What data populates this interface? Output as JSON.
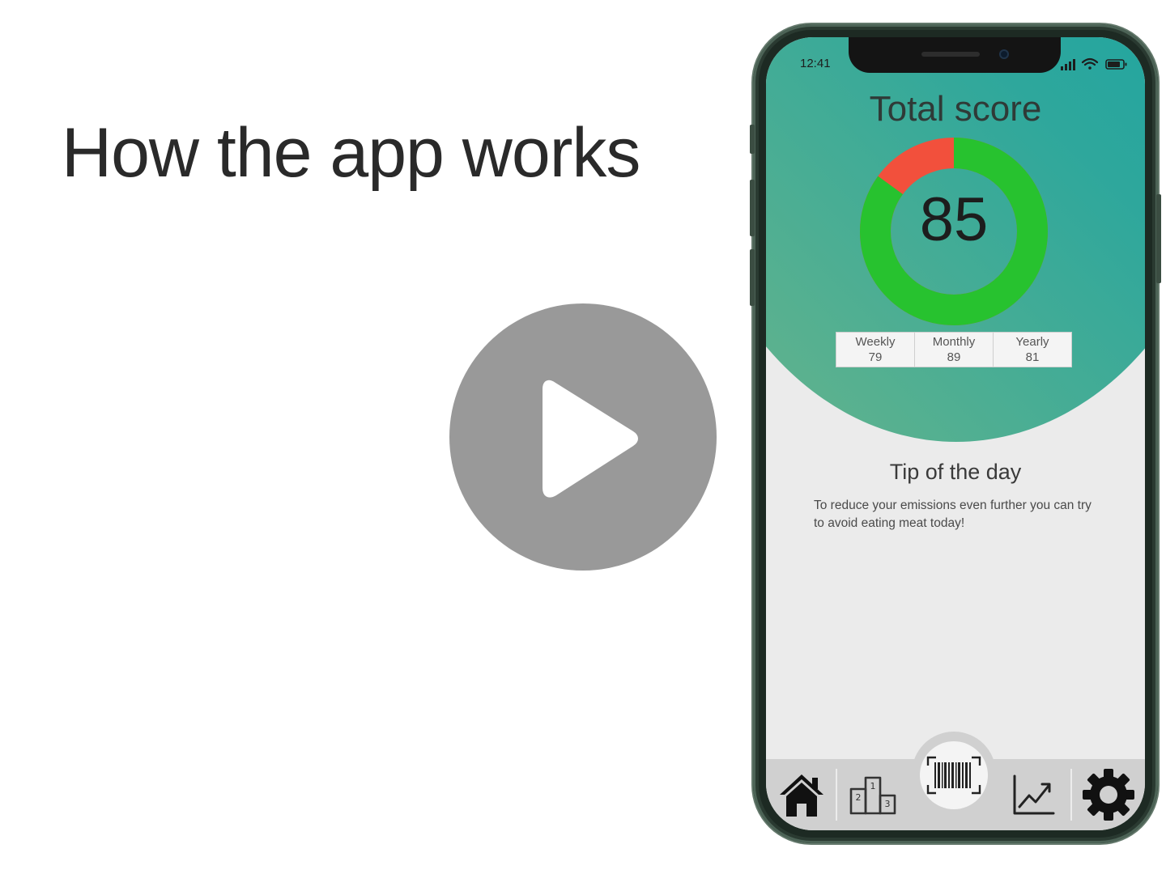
{
  "slide": {
    "title": "How the app works"
  },
  "video": {
    "play_icon": "play-icon"
  },
  "phone": {
    "status_bar": {
      "time": "12:41",
      "icons": [
        "signal-icon",
        "wifi-icon",
        "battery-icon"
      ]
    },
    "score": {
      "title": "Total score",
      "value": "85",
      "fraction": 0.85,
      "colors": {
        "achieved": "#27c22f",
        "remaining": "#f2503c"
      }
    },
    "periods": [
      {
        "label": "Weekly",
        "value": "79"
      },
      {
        "label": "Monthly",
        "value": "89"
      },
      {
        "label": "Yearly",
        "value": "81"
      }
    ],
    "tip": {
      "title": "Tip of the day",
      "text": "To reduce your emissions even further you can try to avoid eating meat today!"
    },
    "tab_bar": {
      "tabs": [
        {
          "icon": "home-icon"
        },
        {
          "icon": "podium-icon"
        },
        {
          "icon": "barcode-scanner-icon"
        },
        {
          "icon": "trend-chart-icon"
        },
        {
          "icon": "gear-icon"
        }
      ]
    },
    "colors": {
      "gradient_start": "#0fa3a6",
      "gradient_end": "#6bb58a",
      "background": "#ebebeb"
    }
  }
}
